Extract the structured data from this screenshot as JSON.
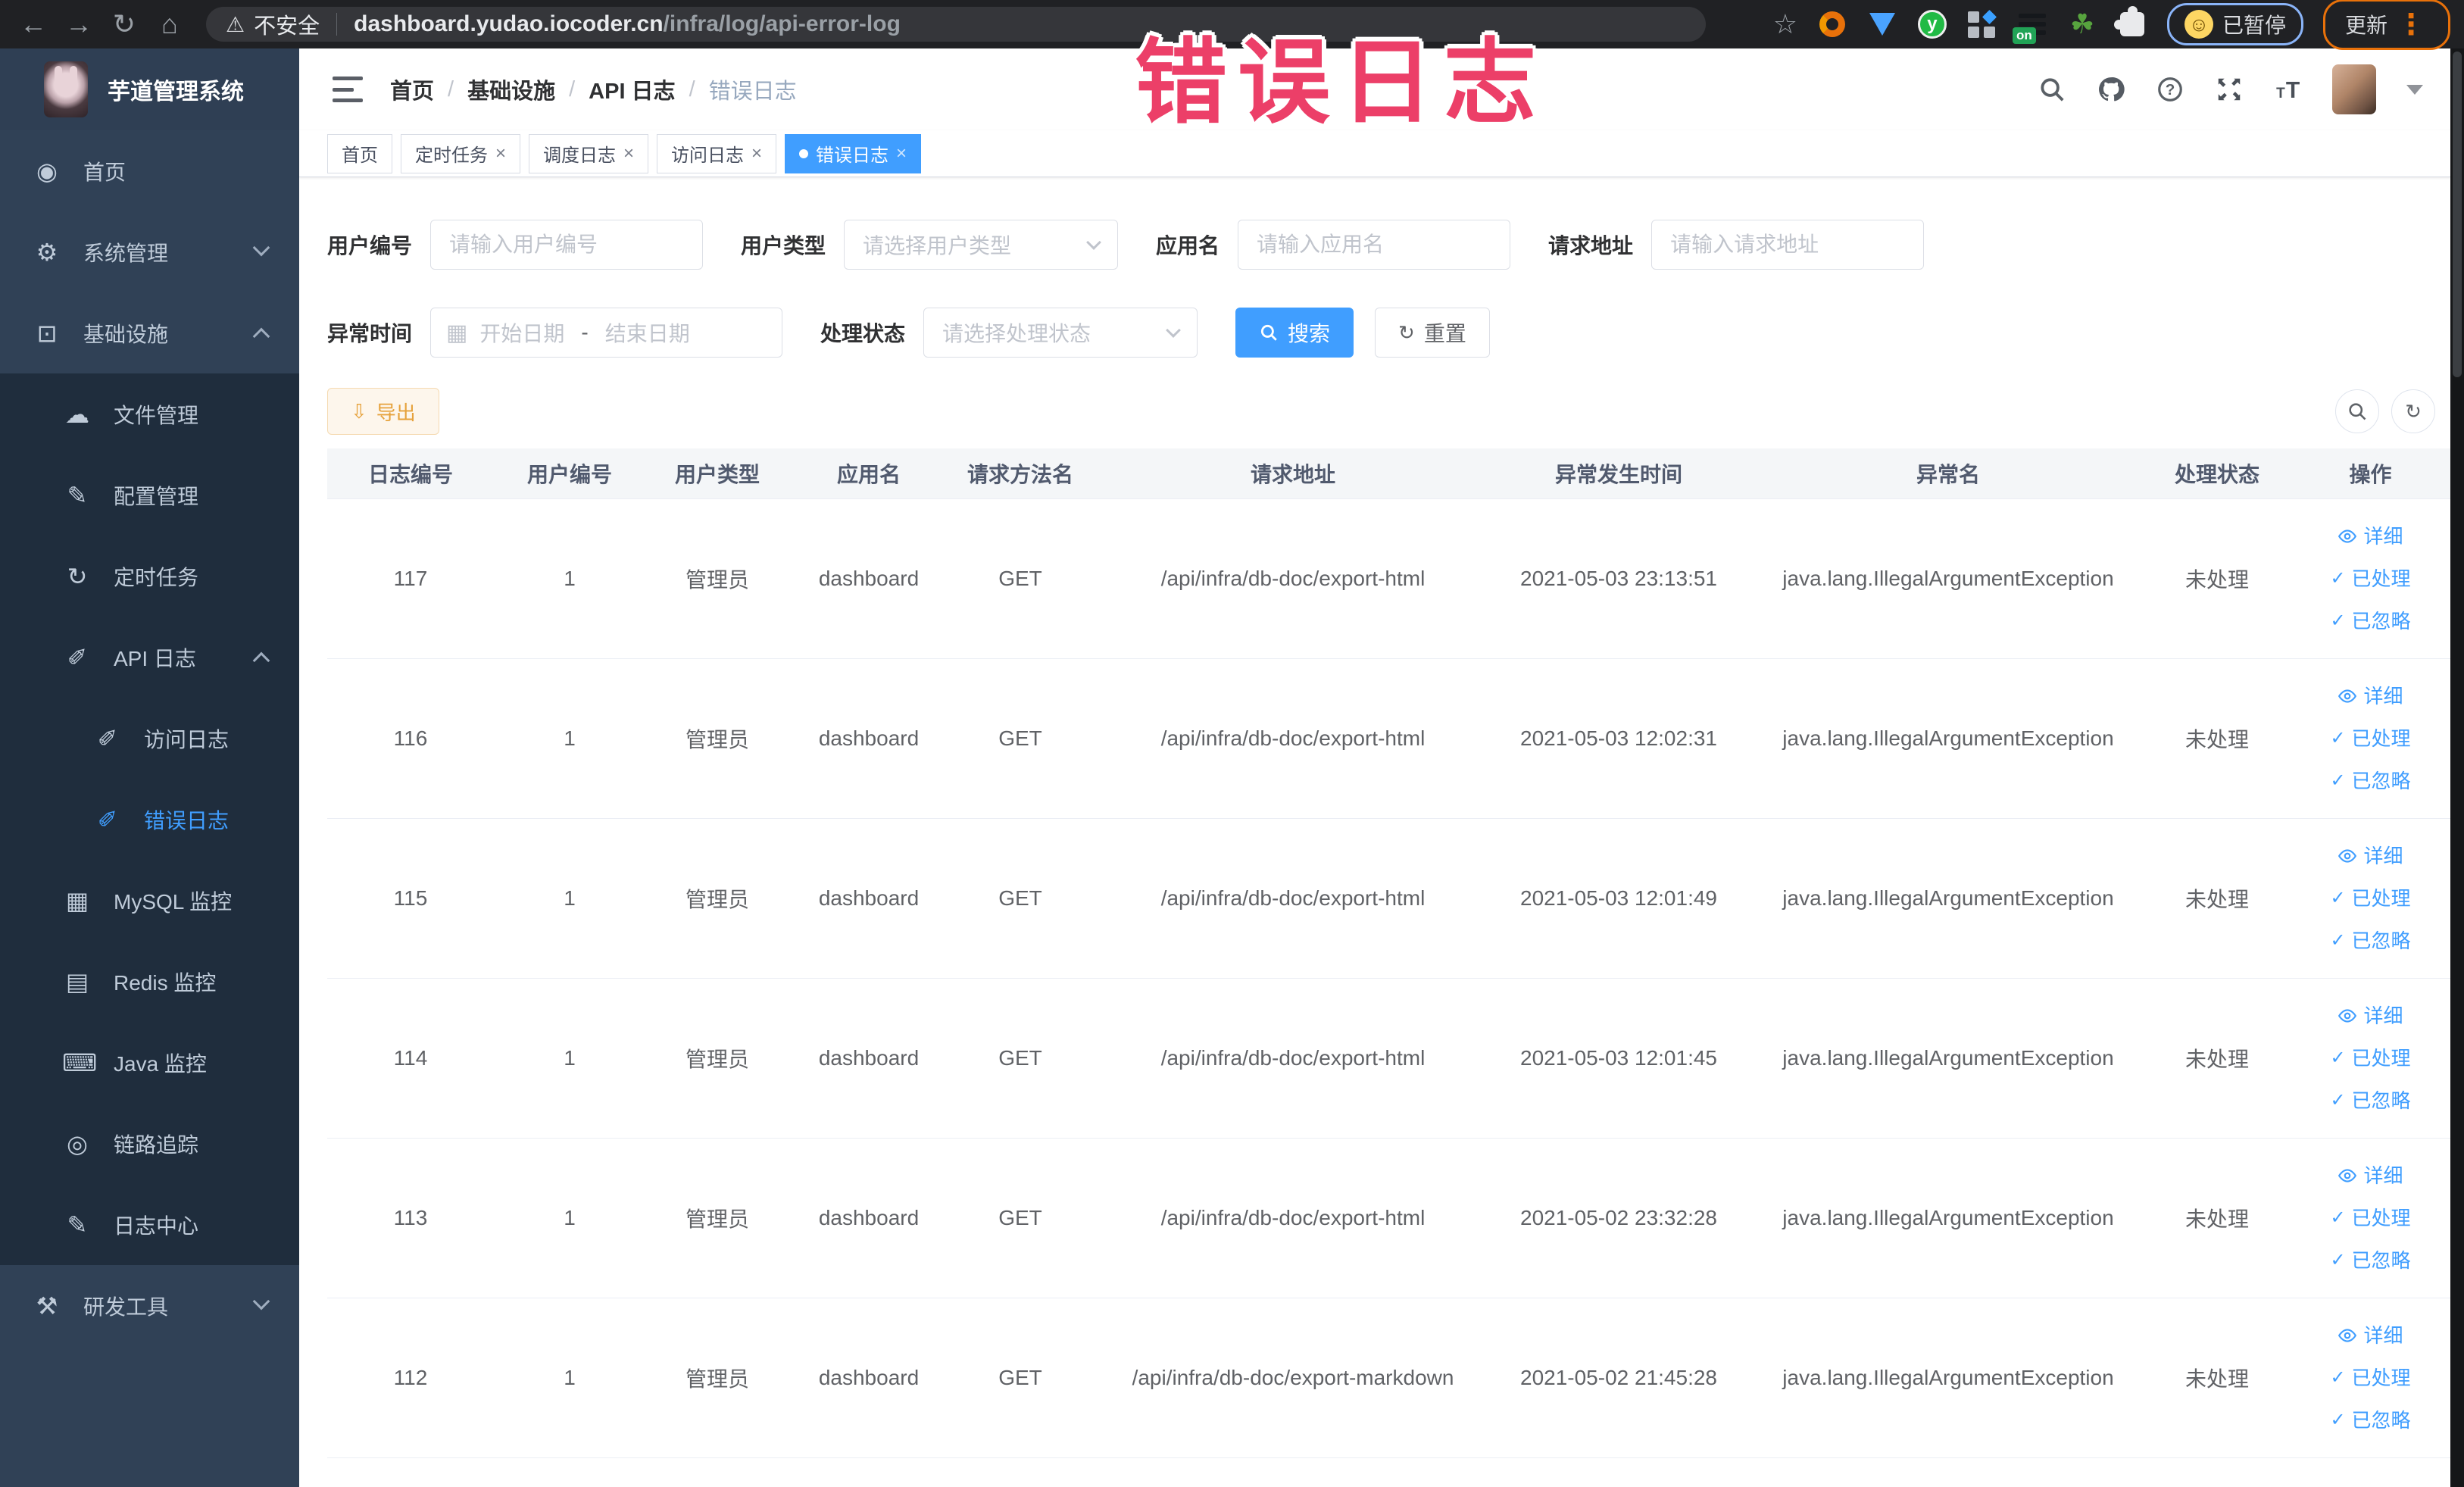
{
  "browser": {
    "security_label": "不安全",
    "url_host": "dashboard.yudao.iocoder.cn",
    "url_path": "/infra/log/api-error-log",
    "on_badge": "on",
    "paused_label": "已暂停",
    "update_label": "更新"
  },
  "annotation": {
    "text": "错误日志",
    "color": "#ec3f68"
  },
  "sidebar": {
    "logo_title": "芋道管理系统",
    "menu": [
      {
        "label": "首页",
        "icon": "dashboard-icon",
        "glyph": "◉",
        "level": "top"
      },
      {
        "label": "系统管理",
        "icon": "gear-icon",
        "glyph": "⚙",
        "level": "top",
        "arrow": "down"
      },
      {
        "label": "基础设施",
        "icon": "monitor-icon",
        "glyph": "⊡",
        "level": "top",
        "arrow": "up"
      },
      {
        "label": "文件管理",
        "icon": "cloud-upload-icon",
        "glyph": "☁",
        "level": "sub"
      },
      {
        "label": "配置管理",
        "icon": "edit-icon",
        "glyph": "✎",
        "level": "sub"
      },
      {
        "label": "定时任务",
        "icon": "timer-icon",
        "glyph": "↻",
        "level": "sub"
      },
      {
        "label": "API 日志",
        "icon": "api-log-icon",
        "glyph": "✐",
        "level": "sub",
        "arrow": "up"
      },
      {
        "label": "访问日志",
        "icon": "access-log-icon",
        "glyph": "✐",
        "level": "sub2"
      },
      {
        "label": "错误日志",
        "icon": "error-log-icon",
        "glyph": "✐",
        "level": "sub2",
        "active": true
      },
      {
        "label": "MySQL 监控",
        "icon": "mysql-monitor-icon",
        "glyph": "▦",
        "level": "sub"
      },
      {
        "label": "Redis 监控",
        "icon": "redis-monitor-icon",
        "glyph": "▤",
        "level": "sub"
      },
      {
        "label": "Java 监控",
        "icon": "java-monitor-icon",
        "glyph": "⌨",
        "level": "sub"
      },
      {
        "label": "链路追踪",
        "icon": "trace-icon",
        "glyph": "◎",
        "level": "sub"
      },
      {
        "label": "日志中心",
        "icon": "log-center-icon",
        "glyph": "✎",
        "level": "sub"
      },
      {
        "label": "研发工具",
        "icon": "toolbox-icon",
        "glyph": "⚒",
        "level": "top",
        "arrow": "down"
      }
    ]
  },
  "navbar": {
    "breadcrumb": [
      "首页",
      "基础设施",
      "API 日志",
      "错误日志"
    ]
  },
  "tabs": [
    {
      "label": "首页",
      "closable": false,
      "active": false
    },
    {
      "label": "定时任务",
      "closable": true,
      "active": false
    },
    {
      "label": "调度日志",
      "closable": true,
      "active": false
    },
    {
      "label": "访问日志",
      "closable": true,
      "active": false
    },
    {
      "label": "错误日志",
      "closable": true,
      "active": true
    }
  ],
  "filters": {
    "user_id": {
      "label": "用户编号",
      "placeholder": "请输入用户编号"
    },
    "user_type": {
      "label": "用户类型",
      "placeholder": "请选择用户类型"
    },
    "app_name": {
      "label": "应用名",
      "placeholder": "请输入应用名"
    },
    "request_url": {
      "label": "请求地址",
      "placeholder": "请输入请求地址"
    },
    "exception_time": {
      "label": "异常时间",
      "start_placeholder": "开始日期",
      "separator": "-",
      "end_placeholder": "结束日期"
    },
    "process_status": {
      "label": "处理状态",
      "placeholder": "请选择处理状态"
    },
    "search_label": "搜索",
    "reset_label": "重置"
  },
  "toolbar": {
    "export_label": "导出"
  },
  "table": {
    "columns": [
      "日志编号",
      "用户编号",
      "用户类型",
      "应用名",
      "请求方法名",
      "请求地址",
      "异常发生时间",
      "异常名",
      "处理状态",
      "操作"
    ],
    "action_labels": {
      "detail": "详细",
      "processed": "已处理",
      "ignored": "已忽略"
    },
    "rows": [
      {
        "id": "117",
        "user_id": "1",
        "user_type": "管理员",
        "app": "dashboard",
        "method": "GET",
        "url": "/api/infra/db-doc/export-html",
        "time": "2021-05-03 23:13:51",
        "exception": "java.lang.IllegalArgumentException",
        "status": "未处理"
      },
      {
        "id": "116",
        "user_id": "1",
        "user_type": "管理员",
        "app": "dashboard",
        "method": "GET",
        "url": "/api/infra/db-doc/export-html",
        "time": "2021-05-03 12:02:31",
        "exception": "java.lang.IllegalArgumentException",
        "status": "未处理"
      },
      {
        "id": "115",
        "user_id": "1",
        "user_type": "管理员",
        "app": "dashboard",
        "method": "GET",
        "url": "/api/infra/db-doc/export-html",
        "time": "2021-05-03 12:01:49",
        "exception": "java.lang.IllegalArgumentException",
        "status": "未处理"
      },
      {
        "id": "114",
        "user_id": "1",
        "user_type": "管理员",
        "app": "dashboard",
        "method": "GET",
        "url": "/api/infra/db-doc/export-html",
        "time": "2021-05-03 12:01:45",
        "exception": "java.lang.IllegalArgumentException",
        "status": "未处理"
      },
      {
        "id": "113",
        "user_id": "1",
        "user_type": "管理员",
        "app": "dashboard",
        "method": "GET",
        "url": "/api/infra/db-doc/export-html",
        "time": "2021-05-02 23:32:28",
        "exception": "java.lang.IllegalArgumentException",
        "status": "未处理"
      },
      {
        "id": "112",
        "user_id": "1",
        "user_type": "管理员",
        "app": "dashboard",
        "method": "GET",
        "url": "/api/infra/db-doc/export-markdown",
        "time": "2021-05-02 21:45:28",
        "exception": "java.lang.IllegalArgumentException",
        "status": "未处理"
      }
    ]
  }
}
